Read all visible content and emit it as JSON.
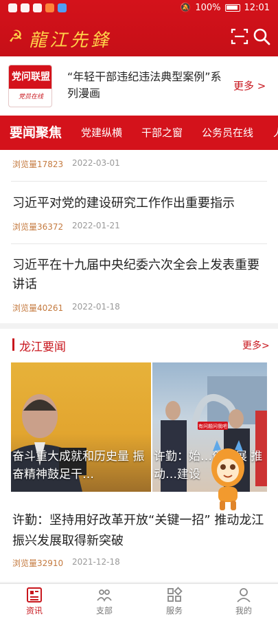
{
  "status_bar": {
    "battery": "100%",
    "time": "12:01"
  },
  "header": {
    "logo_text": "龍江先鋒",
    "icons": [
      "party-emblem-icon",
      "scan-icon",
      "search-icon"
    ]
  },
  "promo": {
    "logo_main": "党问联盟",
    "logo_sub": "党员在线",
    "title": "“年轻干部违纪违法典型案例”系列漫画",
    "more": "更多 >"
  },
  "tabs": [
    {
      "label": "要闻聚焦",
      "active": true
    },
    {
      "label": "党建纵横"
    },
    {
      "label": "干部之窗"
    },
    {
      "label": "公务员在线"
    },
    {
      "label": "人"
    }
  ],
  "news": [
    {
      "views": "浏览量17823",
      "date": "2022-03-01"
    },
    {
      "title": "习近平对党的建设研究工作作出重要指示",
      "views": "浏览量36372",
      "date": "2022-01-21"
    },
    {
      "title": "习近平在十九届中央纪委六次全会上发表重要讲话",
      "views": "浏览量40261",
      "date": "2022-01-18"
    }
  ],
  "section": {
    "title": "龙江要闻",
    "more": "更多>",
    "slides": [
      {
        "caption": "奋斗重大成就和历史量 振奋精神鼓足干…"
      },
      {
        "caption": "许勤：始…创发展 推动…建设",
        "badge": "有问题问我吧"
      }
    ],
    "news": {
      "title": "许勤：坚持用好改革开放“关键一招” 推动龙江振兴发展取得新突破",
      "views": "浏览量32910",
      "date": "2021-12-18"
    }
  },
  "bottom_nav": [
    {
      "label": "资讯",
      "icon": "news-icon",
      "active": true
    },
    {
      "label": "支部",
      "icon": "branch-icon"
    },
    {
      "label": "服务",
      "icon": "service-icon"
    },
    {
      "label": "我的",
      "icon": "profile-icon"
    }
  ],
  "colors": {
    "brand_red": "#d4121b",
    "accent_red": "#c8161d",
    "gold": "#ffd24a",
    "views_orange": "#c47a3f"
  }
}
